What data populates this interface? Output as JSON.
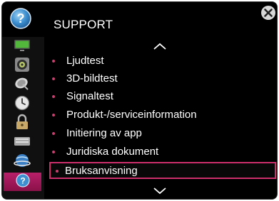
{
  "header": {
    "title": "SUPPORT"
  },
  "sidebar": {
    "items": [
      {
        "icon": "tv-screen-icon"
      },
      {
        "icon": "speaker-icon"
      },
      {
        "icon": "satellite-dish-icon"
      },
      {
        "icon": "clock-icon"
      },
      {
        "icon": "lock-icon"
      },
      {
        "icon": "keyboard-icon"
      },
      {
        "icon": "globe-network-icon"
      },
      {
        "icon": "help-icon",
        "active": true
      }
    ]
  },
  "menu": {
    "items": [
      {
        "label": "Ljudtest"
      },
      {
        "label": "3D-bildtest"
      },
      {
        "label": "Signaltest"
      },
      {
        "label": "Produkt-/serviceinformation"
      },
      {
        "label": "Initiering av app"
      },
      {
        "label": "Juridiska dokument"
      },
      {
        "label": "Bruksanvisning",
        "selected": true
      }
    ]
  },
  "colors": {
    "accent": "#cc2f6c",
    "bullet": "#c83f6f",
    "background": "#000000",
    "text": "#ffffff"
  }
}
